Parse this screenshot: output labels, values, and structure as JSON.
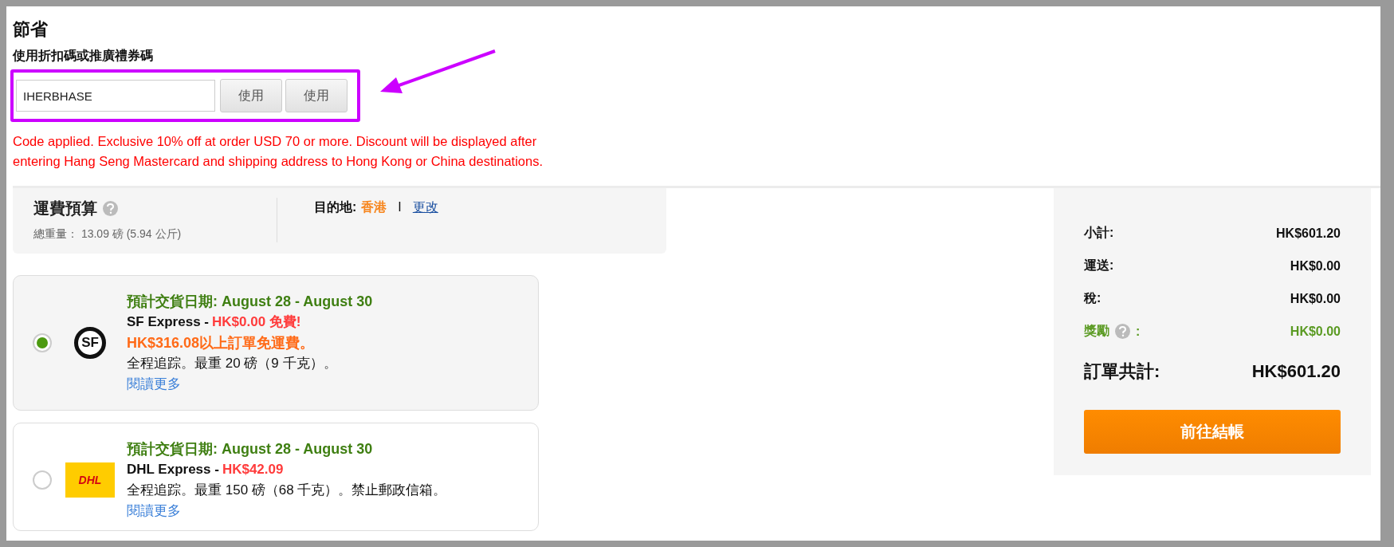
{
  "heading": "節省",
  "promo": {
    "label": "使用折扣碼或推廣禮券碼",
    "value": "IHERBHASE",
    "buttons": [
      "使用",
      "使用"
    ],
    "message": "Code applied. Exclusive 10% off at order USD 70 or more. Discount will be displayed after entering Hang Seng Mastercard and shipping address to Hong Kong or China destinations."
  },
  "shipping_estimate": {
    "title": "運費預算",
    "weight_label": "總重量：",
    "weight": "13.09 磅 (5.94 公斤)",
    "destination_label": "目的地:",
    "destination": "香港",
    "separator": "I",
    "change_link": "更改"
  },
  "shipping_options": [
    {
      "selected": true,
      "kind": "sf",
      "logo_text": "SF",
      "date": "**預計交貨日期**: August 28 - August 30",
      "carrier": "SF Express -",
      "price": "HK$0.00 免費!",
      "free_note": "HK$316.08以上訂單免運費。",
      "description": "全程追踪。最重 20 磅（9 千克）。",
      "more_link": "閱讀更多"
    },
    {
      "selected": false,
      "kind": "dhl",
      "logo_text": "DHL",
      "date": "**預計交貨日期**: August 28 - August 30",
      "carrier": "DHL Express -",
      "price": "HK$42.09",
      "description": "全程追踪。最重 150 磅（68 千克）。禁止郵政信箱。",
      "more_link": "閱讀更多"
    }
  ],
  "summary": {
    "rows": [
      {
        "kind": "normal",
        "label": "小計:",
        "value": "HK$601.20"
      },
      {
        "kind": "normal",
        "label": "運送:",
        "value": "HK$0.00"
      },
      {
        "kind": "normal",
        "label": "稅:",
        "value": "HK$0.00"
      },
      {
        "kind": "reward",
        "label": "獎勵",
        "suffix": ":",
        "value": "HK$0.00"
      },
      {
        "kind": "total",
        "label": "訂單共計:",
        "value": "HK$601.20"
      }
    ],
    "checkout_button": "前往結帳"
  }
}
